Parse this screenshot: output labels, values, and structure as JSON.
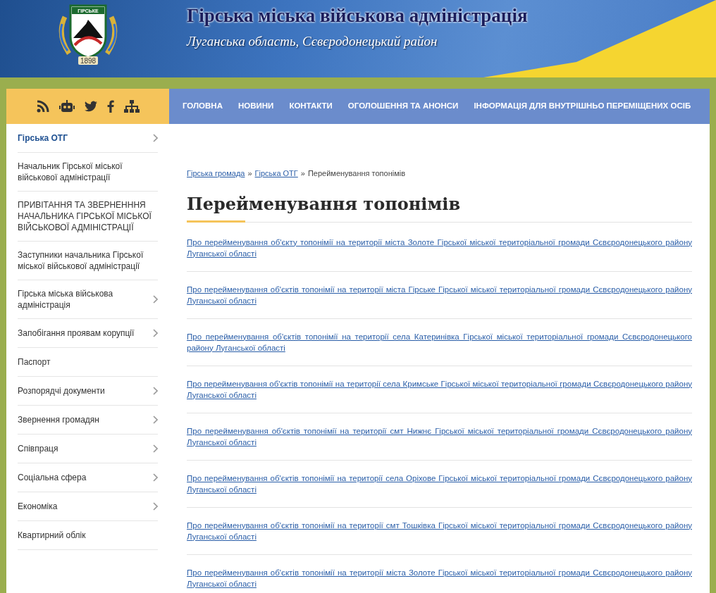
{
  "header": {
    "title": "Гірська міська військова адміністрація",
    "subtitle": "Луганська область, Сєвєродонецький район",
    "logo": {
      "name": "ГІРСЬКЕ",
      "year": "1898"
    }
  },
  "nav": {
    "items": [
      "ГОЛОВНА",
      "НОВИНИ",
      "КОНТАКТИ",
      "ОГОЛОШЕННЯ ТА АНОНСИ",
      "ІНФОРМАЦІЯ ДЛЯ ВНУТРІШНЬО ПЕРЕМІЩЕНИХ ОСІБ"
    ]
  },
  "sidebar": {
    "items": [
      {
        "label": "Гірська ОТГ",
        "selected": true,
        "has_children": true
      },
      {
        "label": "Начальник Гірської міської військової адміністрації",
        "selected": false,
        "has_children": false
      },
      {
        "label": "ПРИВІТАННЯ ТА ЗВЕРНЕНННЯ НАЧАЛЬНИКА ГІРСЬКОЇ МІСЬКОЇ ВІЙСЬКОВОЇ АДМІНІСТРАЦІЇ",
        "selected": false,
        "has_children": false
      },
      {
        "label": "Заступники начальника Гірської міської військової адміністрації",
        "selected": false,
        "has_children": false
      },
      {
        "label": "Гірська міська військова адміністрація",
        "selected": false,
        "has_children": true
      },
      {
        "label": "Запобігання проявам корупції",
        "selected": false,
        "has_children": true
      },
      {
        "label": "Паспорт",
        "selected": false,
        "has_children": false
      },
      {
        "label": "Розпорядчі документи",
        "selected": false,
        "has_children": true
      },
      {
        "label": "Звернення громадян",
        "selected": false,
        "has_children": true
      },
      {
        "label": "Співпраця",
        "selected": false,
        "has_children": true
      },
      {
        "label": "Соціальна сфера",
        "selected": false,
        "has_children": true
      },
      {
        "label": "Економіка",
        "selected": false,
        "has_children": true
      },
      {
        "label": "Квартирний облік",
        "selected": false,
        "has_children": false
      }
    ]
  },
  "breadcrumb": {
    "links": [
      "Гірська громада",
      "Гірська ОТГ"
    ],
    "separator": "»",
    "current": "Перейменування топонімів"
  },
  "page_title": "Перейменування топонімів",
  "articles": [
    "Про перейменування об'єкту топонімії на території міста Золоте Гірської міської територіальної громади Сєвєродонецького району Луганської області",
    "Про перейменування об'єктів топонімії на території міста Гірське Гірської міської територіальної громади Сєвєродонецького району Луганської області",
    "Про перейменування об'єктів топонімії на території села Катеринівка Гірської міської територіальної громади Сєвєродонецького району Луганської області",
    "Про перейменування об'єктів топонімії на території села Кримське Гірської міської територіальної громади Сєвєродонецького району Луганської області",
    "Про перейменування об'єктів топонімії на території смт Нижнє Гірської міської територіальної громади Сєвєродонецького району Луганської області",
    "Про перейменування об'єктів топонімії на території села Оріхове Гірської міської територіальної громади Сєвєродонецького району Луганської області",
    "Про перейменування об'єктів топонімії на території смт Тошківка Гірської міської територіальної громади Сєвєродонецького району Луганської області",
    "Про перейменування об'єктів топонімії на території міста Золоте Гірської міської територіальної громади Сєвєродонецького району Луганської області"
  ]
}
